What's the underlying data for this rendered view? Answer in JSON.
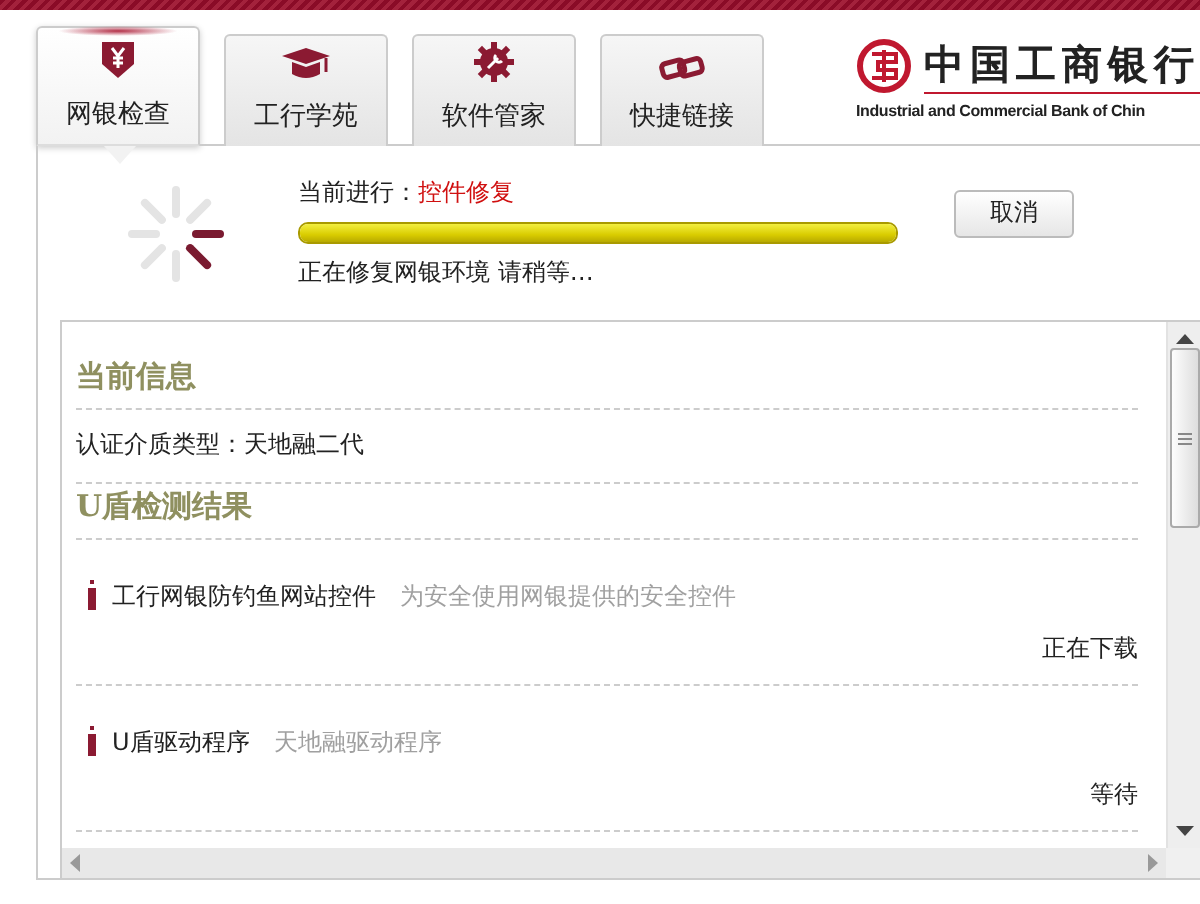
{
  "tabs": [
    {
      "label": "网银检查",
      "selected": true
    },
    {
      "label": "工行学苑",
      "selected": false
    },
    {
      "label": "软件管家",
      "selected": false
    },
    {
      "label": "快捷链接",
      "selected": false
    }
  ],
  "logo": {
    "name": "中国工商银行",
    "english": "Industrial and Commercial Bank of Chin"
  },
  "progress": {
    "label": "当前进行：",
    "task": "控件修复",
    "level": 1,
    "status": "正在修复网银环境 请稍等…",
    "button": "取消"
  },
  "sections": [
    {
      "title": "当前信息",
      "items": [
        {
          "kind": "info",
          "text": "认证介质类型：天地融二代"
        }
      ]
    },
    {
      "title": "U盾检测结果",
      "items": [
        {
          "kind": "check",
          "name": "工行网银防钓鱼网站控件",
          "description": "为安全使用网银提供的安全控件",
          "status": "正在下载"
        },
        {
          "kind": "check",
          "name": "U盾驱动程序",
          "description": "天地融驱动程序",
          "status": "等待"
        }
      ]
    }
  ]
}
